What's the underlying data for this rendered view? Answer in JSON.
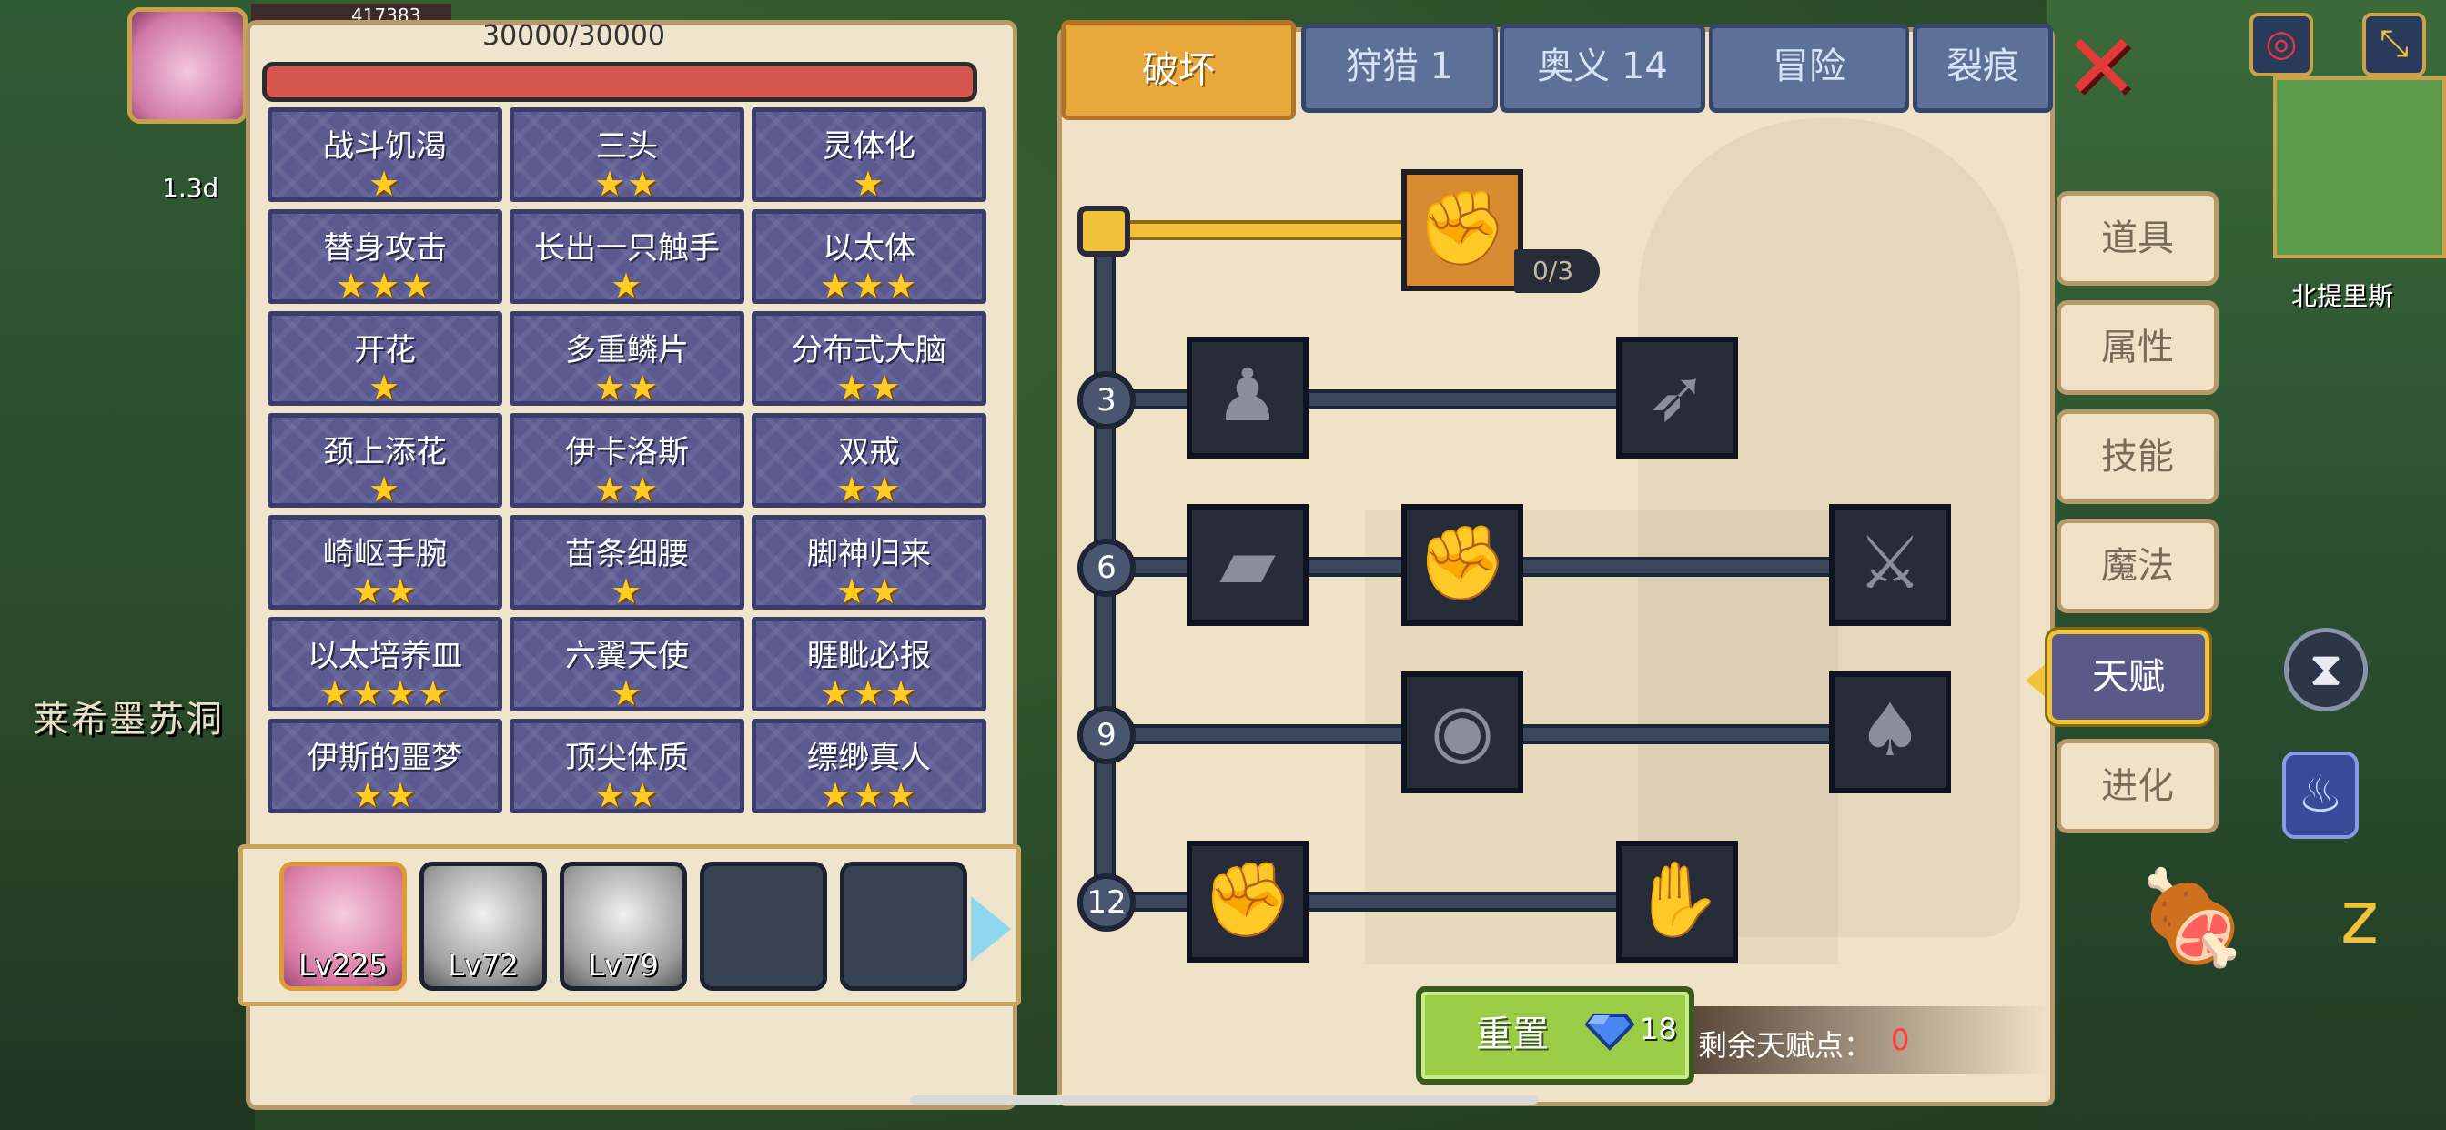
{
  "hud": {
    "hp_value": "417383",
    "time_label": "1.3d",
    "left_location": "莱希墨苏洞",
    "map_location": "北提里斯"
  },
  "character_panel": {
    "hp_text": "30000/30000",
    "traits": [
      {
        "name": "战斗饥渴",
        "stars": "★"
      },
      {
        "name": "三头",
        "stars": "★★"
      },
      {
        "name": "灵体化",
        "stars": "★"
      },
      {
        "name": "替身攻击",
        "stars": "★★★"
      },
      {
        "name": "长出一只触手",
        "stars": "★"
      },
      {
        "name": "以太体",
        "stars": "★★★"
      },
      {
        "name": "开花",
        "stars": "★"
      },
      {
        "name": "多重鳞片",
        "stars": "★★"
      },
      {
        "name": "分布式大脑",
        "stars": "★★"
      },
      {
        "name": "颈上添花",
        "stars": "★"
      },
      {
        "name": "伊卡洛斯",
        "stars": "★★"
      },
      {
        "name": "双戒",
        "stars": "★★"
      },
      {
        "name": "崎岖手腕",
        "stars": "★★"
      },
      {
        "name": "苗条细腰",
        "stars": "★"
      },
      {
        "name": "脚神归来",
        "stars": "★★"
      },
      {
        "name": "以太培养皿",
        "stars": "★★★★"
      },
      {
        "name": "六翼天使",
        "stars": "★"
      },
      {
        "name": "睚眦必报",
        "stars": "★★★"
      },
      {
        "name": "伊斯的噩梦",
        "stars": "★★"
      },
      {
        "name": "顶尖体质",
        "stars": "★★"
      },
      {
        "name": "缥缈真人",
        "stars": "★★★"
      }
    ],
    "party": [
      {
        "level": "Lv225",
        "selected": true
      },
      {
        "level": "Lv72",
        "selected": false
      },
      {
        "level": "Lv79",
        "selected": false
      },
      {
        "level": "",
        "selected": false
      },
      {
        "level": "",
        "selected": false
      }
    ]
  },
  "tabs": [
    {
      "label": "破坏",
      "active": true
    },
    {
      "label": "狩猎 1",
      "active": false
    },
    {
      "label": "奥义 14",
      "active": false
    },
    {
      "label": "冒险",
      "active": false
    },
    {
      "label": "裂痕",
      "active": false
    }
  ],
  "side_menu": [
    {
      "label": "道具",
      "active": false
    },
    {
      "label": "属性",
      "active": false
    },
    {
      "label": "技能",
      "active": false
    },
    {
      "label": "魔法",
      "active": false
    },
    {
      "label": "天赋",
      "active": true
    },
    {
      "label": "进化",
      "active": false
    }
  ],
  "talent_tree": {
    "top_node_progress": "0/3",
    "tier_labels": [
      "3",
      "6",
      "9",
      "12"
    ],
    "nodes": [
      {
        "icon": "arm-wrestle-icon",
        "unlocked": true
      },
      {
        "icon": "muscle-body-icon",
        "unlocked": false
      },
      {
        "icon": "arrow-bow-icon",
        "unlocked": false
      },
      {
        "icon": "card-break-icon",
        "unlocked": false
      },
      {
        "icon": "fist-punch-icon",
        "unlocked": false
      },
      {
        "icon": "blood-slash-icon",
        "unlocked": false
      },
      {
        "icon": "ripple-target-icon",
        "unlocked": false
      },
      {
        "icon": "bat-drop-icon",
        "unlocked": false
      },
      {
        "icon": "raised-fist-icon",
        "unlocked": false
      },
      {
        "icon": "grab-hand-icon",
        "unlocked": false
      }
    ]
  },
  "footer": {
    "reset_label": "重置",
    "reset_cost": "18",
    "points_label": "剩余天赋点：",
    "points_value": "0"
  },
  "colors": {
    "accent_gold": "#f2c33a",
    "tab_active": "#e8a83c",
    "tab_inactive": "#5d7098",
    "trait_bg": "#5a5a90",
    "reset_green": "#9acd45",
    "points_red": "#ff3a3a"
  }
}
